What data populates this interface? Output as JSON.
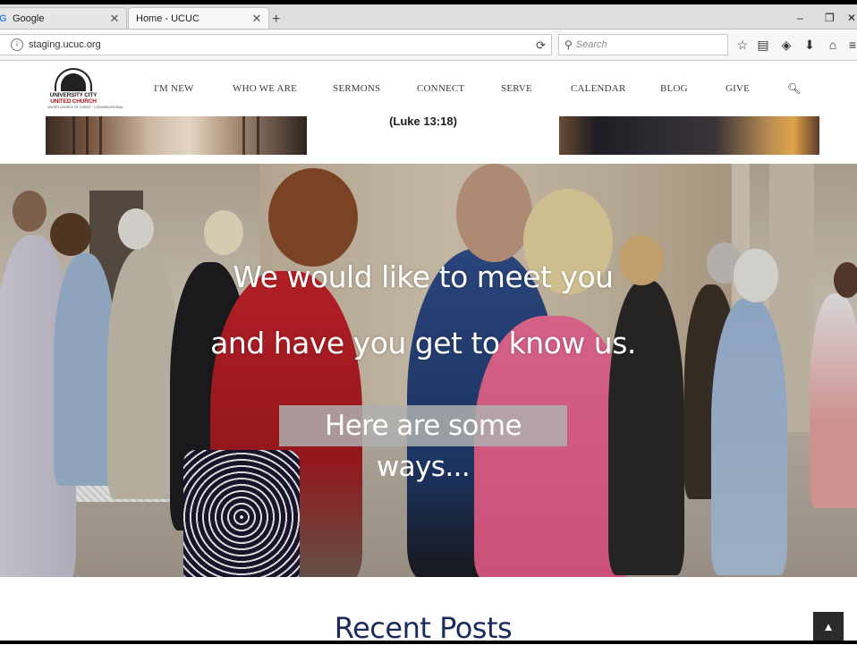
{
  "browser": {
    "tabs": [
      {
        "title": "Google",
        "favicon": "G",
        "active": false
      },
      {
        "title": "Home - UCUC",
        "favicon": "",
        "active": true
      }
    ],
    "new_tab_symbol": "+",
    "url": "staging.ucuc.org",
    "search_placeholder": "Search",
    "window_controls": {
      "minimize": "‒",
      "restore": "❐",
      "close": "✕"
    }
  },
  "site": {
    "logo": {
      "line1": "UNIVERSITY CITY",
      "line2": "UNITED CHURCH",
      "tagline": "UNITED CHURCH OF CHRIST · CONGREGATIONAL"
    },
    "menu": [
      "I'M NEW",
      "WHO WE ARE",
      "SERMONS",
      "CONNECT",
      "SERVE",
      "CALENDAR",
      "BLOG",
      "GIVE"
    ],
    "verse": "(Luke 13:18)",
    "hero": {
      "line1": "We would like to meet you",
      "line2": "and have you get to know us.",
      "cta": "Here are some ways..."
    },
    "recent_posts_heading": "Recent Posts"
  },
  "colors": {
    "accent_navy": "#1b2a5c",
    "logo_red": "#b0141f"
  }
}
